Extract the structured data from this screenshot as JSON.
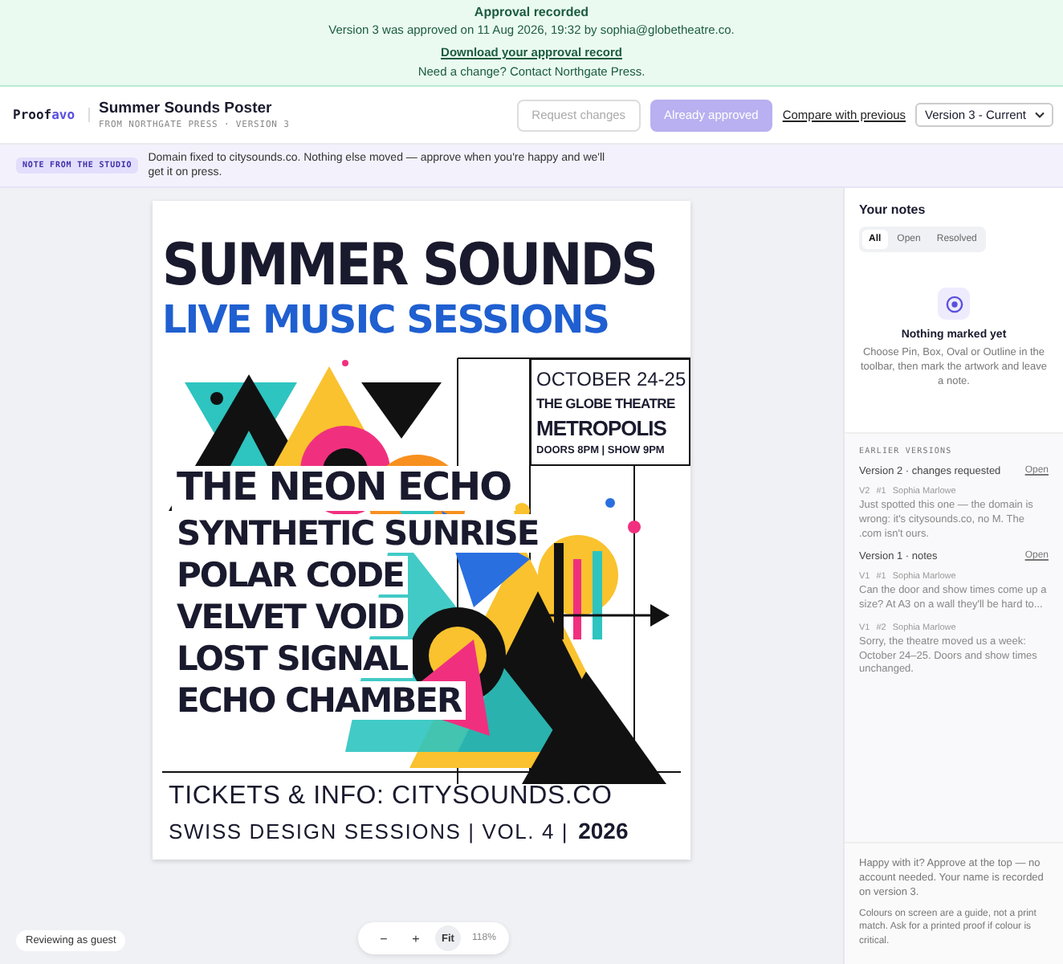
{
  "banner": {
    "title": "Approval recorded",
    "message": "Version 3 was approved on 11 Aug 2026, 19:32 by sophia@globetheatre.co.",
    "link": "Download your approval record",
    "contact": "Need a change? Contact Northgate Press."
  },
  "header": {
    "logo": [
      "Proof",
      "avo"
    ],
    "title": "Summer Sounds Poster",
    "subtitle": "FROM NORTHGATE PRESS · VERSION 3",
    "buttons": [
      {
        "label": "Request changes",
        "kind": "secondary",
        "disabled": true
      },
      {
        "label": "Already approved",
        "kind": "primary",
        "disabled": true
      }
    ],
    "compare_link": "Compare with previous",
    "version_select": "Version 3 - Current"
  },
  "studio_note": {
    "tag": "NOTE FROM THE STUDIO",
    "text": "Domain fixed to citysounds.co. Nothing else moved — approve when you're happy and we'll get it on press."
  },
  "poster": {
    "title": "SUMMER SOUNDS",
    "subtitle": "LIVE MUSIC SESSIONS",
    "info": {
      "date": "OCTOBER 24-25",
      "venue": "THE GLOBE THEATRE",
      "city": "METROPOLIS",
      "times": "DOORS 8PM | SHOW 9PM"
    },
    "lineup": [
      "THE NEON ECHO",
      "SYNTHETIC SUNRISE",
      "POLAR CODE",
      "VELVET VOID",
      "LOST SIGNAL",
      "ECHO CHAMBER"
    ],
    "tickets": "TICKETS & INFO:  CITYSOUNDS.CO",
    "series": "SWISS DESIGN SESSIONS | VOL. 4 |",
    "year": "2026"
  },
  "zoom_controls": {
    "buttons": [
      {
        "label": "−",
        "selected": false
      },
      {
        "label": "+",
        "selected": false
      },
      {
        "label": "Fit",
        "selected": true
      }
    ],
    "reading": "118%"
  },
  "guest_badge": "Reviewing as guest",
  "sidebar": {
    "title": "Your notes",
    "filters": [
      {
        "label": "All",
        "selected": true
      },
      {
        "label": "Open",
        "selected": false
      },
      {
        "label": "Resolved",
        "selected": false
      }
    ],
    "empty": {
      "title": "Nothing marked yet",
      "text": "Choose Pin, Box, Oval or Outline in the toolbar, then mark the artwork and leave a note."
    },
    "earlier_heading": "EARLIER VERSIONS",
    "versions": [
      {
        "title": "Version 2 · changes requested",
        "action": "Open",
        "notes": [
          {
            "version": "V2",
            "number": "#1",
            "author": "Sophia Marlowe",
            "text": "Just spotted this one — the domain is wrong: it's citysounds.co, no M. The .com isn't ours."
          }
        ]
      },
      {
        "title": "Version 1 · notes",
        "action": "Open",
        "notes": [
          {
            "version": "V1",
            "number": "#1",
            "author": "Sophia Marlowe",
            "text": "Can the door and show times come up a size? At A3 on a wall they'll be hard to..."
          },
          {
            "version": "V1",
            "number": "#2",
            "author": "Sophia Marlowe",
            "text": "Sorry, the theatre moved us a week: October 24–25. Doors and show times unchanged."
          }
        ]
      }
    ],
    "footer": [
      "Happy with it? Approve at the top — no account needed. Your name is recorded on version 3.",
      "Colours on screen are a guide, not a print match. Ask for a printed proof if colour is critical."
    ]
  }
}
